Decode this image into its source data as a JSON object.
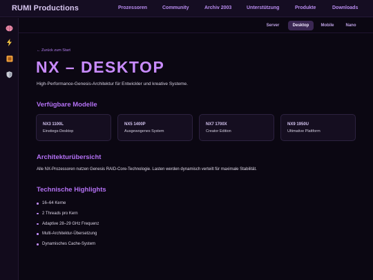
{
  "header": {
    "brand": "RUMI Productions",
    "nav": [
      "Prozessoren",
      "Community",
      "Archiv 2003",
      "Unterstützung",
      "Produkte",
      "Downloads"
    ]
  },
  "sidebar": {
    "icons": [
      "brain-icon",
      "lightning-icon",
      "box-icon",
      "shield-icon"
    ]
  },
  "subnav": {
    "tabs": [
      "Server",
      "Desktop",
      "Mobile",
      "Nano"
    ],
    "active": "Desktop"
  },
  "main": {
    "back_link": "← Zurück zum Start",
    "title": "NX – DESKTOP",
    "subtitle": "High-Performance-Genesis-Architektur für Entwickler und kreative Systeme.",
    "models_heading": "Verfügbare Modelle",
    "models": [
      {
        "name": "NX3 1100L",
        "desc": "Einstiegs-Desktop"
      },
      {
        "name": "NX5 1400P",
        "desc": "Ausgewogenes System"
      },
      {
        "name": "NX7 1700X",
        "desc": "Creator Edition"
      },
      {
        "name": "NX9 1950U",
        "desc": "Ultimative Plattform"
      }
    ],
    "architecture_heading": "Architekturübersicht",
    "architecture_text": "Alle NX-Prozessoren nutzen Genesis RAID-Core-Technologie. Lasten werden dynamisch verteilt für maximale Stabilität.",
    "highlights_heading": "Technische Highlights",
    "highlights": [
      "16–64 Kerne",
      "2 Threads pro Kern",
      "Adaptive 28–29 GHz Frequenz",
      "Multi-Architektur-Übersetzung",
      "Dynamisches Cache-System"
    ]
  },
  "colors": {
    "accent": "#c98bff",
    "heading": "#b471f5",
    "background": "#0b0712"
  }
}
